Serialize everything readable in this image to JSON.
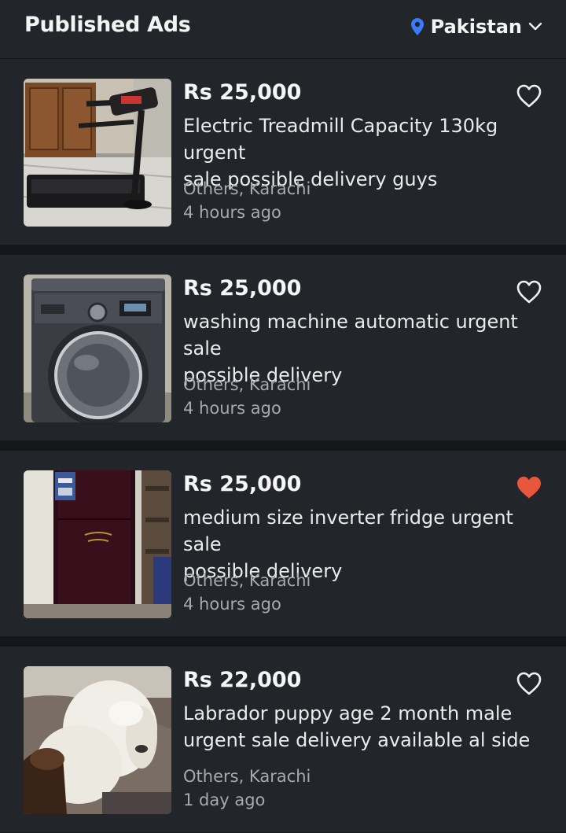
{
  "header": {
    "title": "Published Ads",
    "location": "Pakistan",
    "location_icon": "location-pin-icon",
    "dropdown_icon": "chevron-down-icon"
  },
  "colors": {
    "background": "#15171b",
    "card": "#22252a",
    "pin": "#3a7afe",
    "favorite": "#e8573c"
  },
  "ads": [
    {
      "price": "Rs 25,000",
      "title": "Electric Treadmill Capacity 130kg urgent\nsale possible delivery guys",
      "location": "Others, Karachi",
      "time": "4 hours ago",
      "favorited": false
    },
    {
      "price": "Rs 25,000",
      "title": "washing machine automatic urgent sale\npossible delivery",
      "location": "Others, Karachi",
      "time": "4 hours ago",
      "favorited": false
    },
    {
      "price": "Rs 25,000",
      "title": "medium size inverter fridge urgent sale\npossible delivery",
      "location": "Others, Karachi",
      "time": "4 hours ago",
      "favorited": true
    },
    {
      "price": "Rs 22,000",
      "title": "Labrador puppy age 2 month male\nurgent sale delivery available al side",
      "location": "Others, Karachi",
      "time": "1 day ago",
      "favorited": false
    }
  ]
}
